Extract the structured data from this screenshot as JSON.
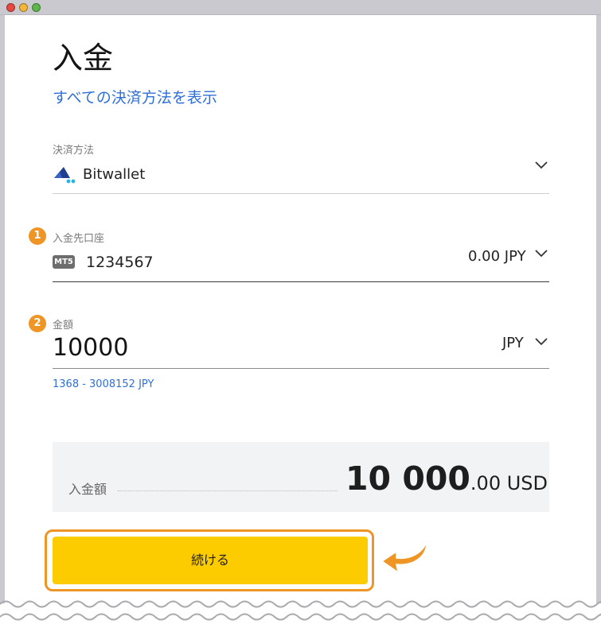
{
  "page": {
    "title": "入金",
    "show_all_methods": "すべての決済方法を表示"
  },
  "payment_method": {
    "label": "決済方法",
    "value": "Bitwallet",
    "icon": "bitwallet-icon"
  },
  "account": {
    "step": "1",
    "label": "入金先口座",
    "badge": "MT5",
    "number": "1234567",
    "balance": "0.00 JPY"
  },
  "amount": {
    "step": "2",
    "label": "金額",
    "value": "10000",
    "currency": "JPY",
    "range": "1368 - 3008152 JPY"
  },
  "summary": {
    "label": "入金額",
    "amount_main": "10 000",
    "amount_decimal": ".00 USD"
  },
  "continue_button": {
    "label": "続ける"
  },
  "colors": {
    "accent": "#ee9526",
    "button": "#fdcc00",
    "link": "#2f6fd6"
  }
}
